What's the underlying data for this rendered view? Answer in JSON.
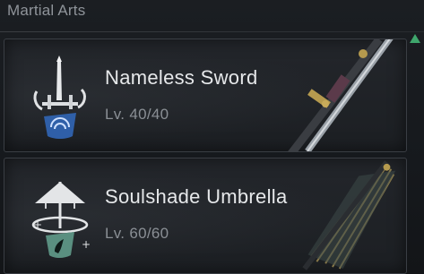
{
  "section": {
    "title": "Martial Arts"
  },
  "arts": [
    {
      "name": "Nameless Sword",
      "level": "Lv. 40/40",
      "icon": "sword-skill-icon",
      "weapon": "sword-image"
    },
    {
      "name": "Soulshade Umbrella",
      "level": "Lv. 60/60",
      "icon": "umbrella-skill-icon",
      "weapon": "umbrella-image"
    }
  ],
  "colors": {
    "scroll_indicator": "#3fa66c",
    "badge_blue": "#2f5fa8",
    "badge_teal": "#5a8f80"
  }
}
